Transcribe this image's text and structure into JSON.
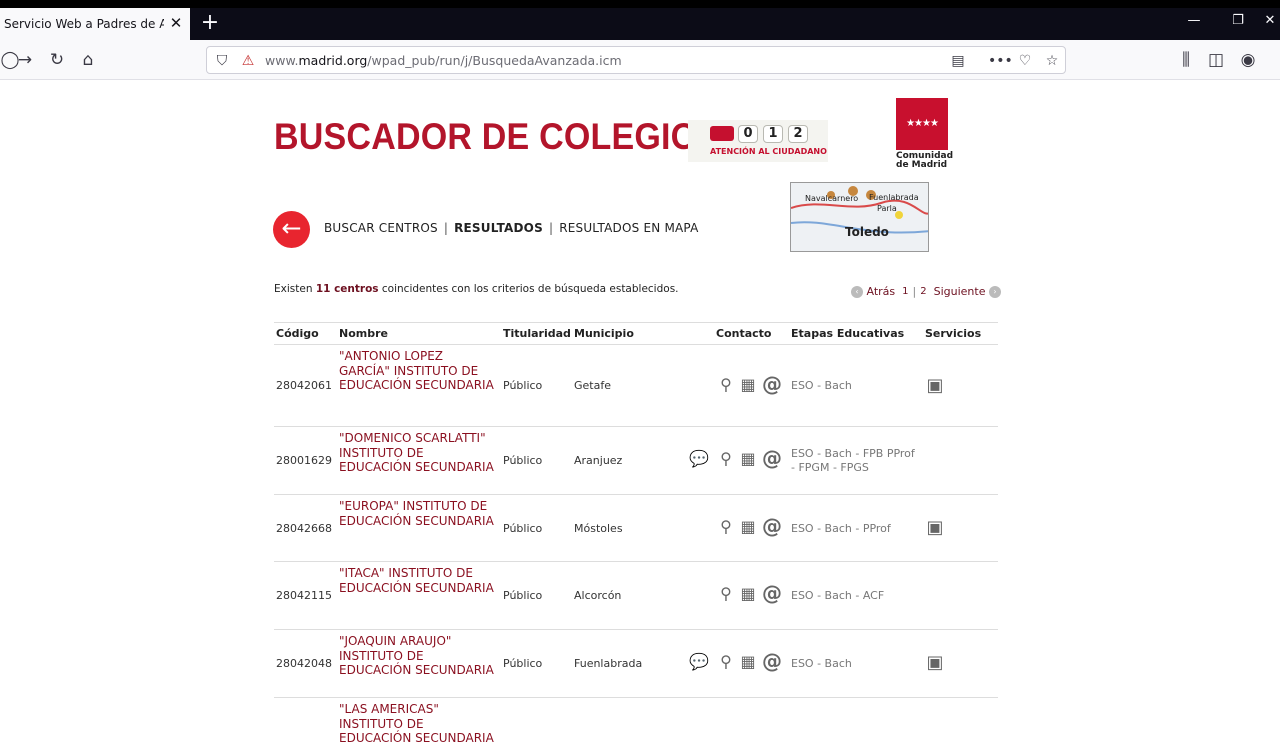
{
  "browser": {
    "tab_title": "Servicio Web a Padres de Alumnos",
    "url_prefix": "www.",
    "url_domain": "madrid.org",
    "url_path": "/wpad_pub/run/j/BusquedaAvanzada.icm"
  },
  "header": {
    "title": "BUSCADOR DE COLEGIOS",
    "badge_digits": [
      "0",
      "1",
      "2"
    ],
    "badge_caption": "ATENCIÓN AL CIUDADANO",
    "cm_caption_line1": "Comunidad",
    "cm_caption_line2": "de Madrid",
    "map_labels": [
      "Navalcarnero",
      "Fuenlabrada",
      "Parla"
    ],
    "map_city": "Toledo"
  },
  "nav": {
    "buscar": "BUSCAR CENTROS",
    "resultados": "RESULTADOS",
    "mapa": "RESULTADOS EN MAPA",
    "separator": "|"
  },
  "summary": {
    "prefix": "Existen",
    "count": "11 centros",
    "suffix": "coincidentes con los criterios de búsqueda establecidos."
  },
  "pager": {
    "back": "Atrás",
    "page1": "1",
    "page2": "2",
    "next": "Siguiente"
  },
  "table": {
    "headers": {
      "codigo": "Código",
      "nombre": "Nombre",
      "titularidad": "Titularidad",
      "municipio": "Municipio",
      "contacto": "Contacto",
      "etapas": "Etapas Educativas",
      "servicios": "Servicios"
    },
    "rows": [
      {
        "codigo": "28042061",
        "nombre": "\"ANTONIO LOPEZ GARCÍA\" INSTITUTO DE EDUCACIÓN SECUNDARIA",
        "titularidad": "Público",
        "municipio": "Getafe",
        "etapas": "ESO - Bach",
        "extra_contact": false,
        "bus": true
      },
      {
        "codigo": "28001629",
        "nombre": "\"DOMENICO SCARLATTI\" INSTITUTO DE EDUCACIÓN SECUNDARIA",
        "titularidad": "Público",
        "municipio": "Aranjuez",
        "etapas": "ESO - Bach - FPB PProf - FPGM - FPGS",
        "extra_contact": true,
        "bus": false
      },
      {
        "codigo": "28042668",
        "nombre": "\"EUROPA\" INSTITUTO DE EDUCACIÓN SECUNDARIA",
        "titularidad": "Público",
        "municipio": "Móstoles",
        "etapas": "ESO - Bach - PProf",
        "extra_contact": false,
        "bus": true
      },
      {
        "codigo": "28042115",
        "nombre": "\"ITACA\" INSTITUTO DE EDUCACIÓN SECUNDARIA",
        "titularidad": "Público",
        "municipio": "Alcorcón",
        "etapas": "ESO - Bach - ACF",
        "extra_contact": false,
        "bus": false
      },
      {
        "codigo": "28042048",
        "nombre": "\"JOAQUIN ARAUJO\" INSTITUTO DE EDUCACIÓN SECUNDARIA",
        "titularidad": "Público",
        "municipio": "Fuenlabrada",
        "etapas": "ESO - Bach",
        "extra_contact": true,
        "bus": true
      },
      {
        "codigo": "",
        "nombre": "\"LAS AMERICAS\" INSTITUTO DE EDUCACIÓN SECUNDARIA",
        "titularidad": "",
        "municipio": "",
        "etapas": "",
        "extra_contact": false,
        "bus": false
      }
    ]
  },
  "icons": {
    "location": "map-pin-icon",
    "phone": "phone-fax-icon",
    "email": "at-sign-icon",
    "chat": "chat-icon",
    "bus": "bus-icon"
  }
}
